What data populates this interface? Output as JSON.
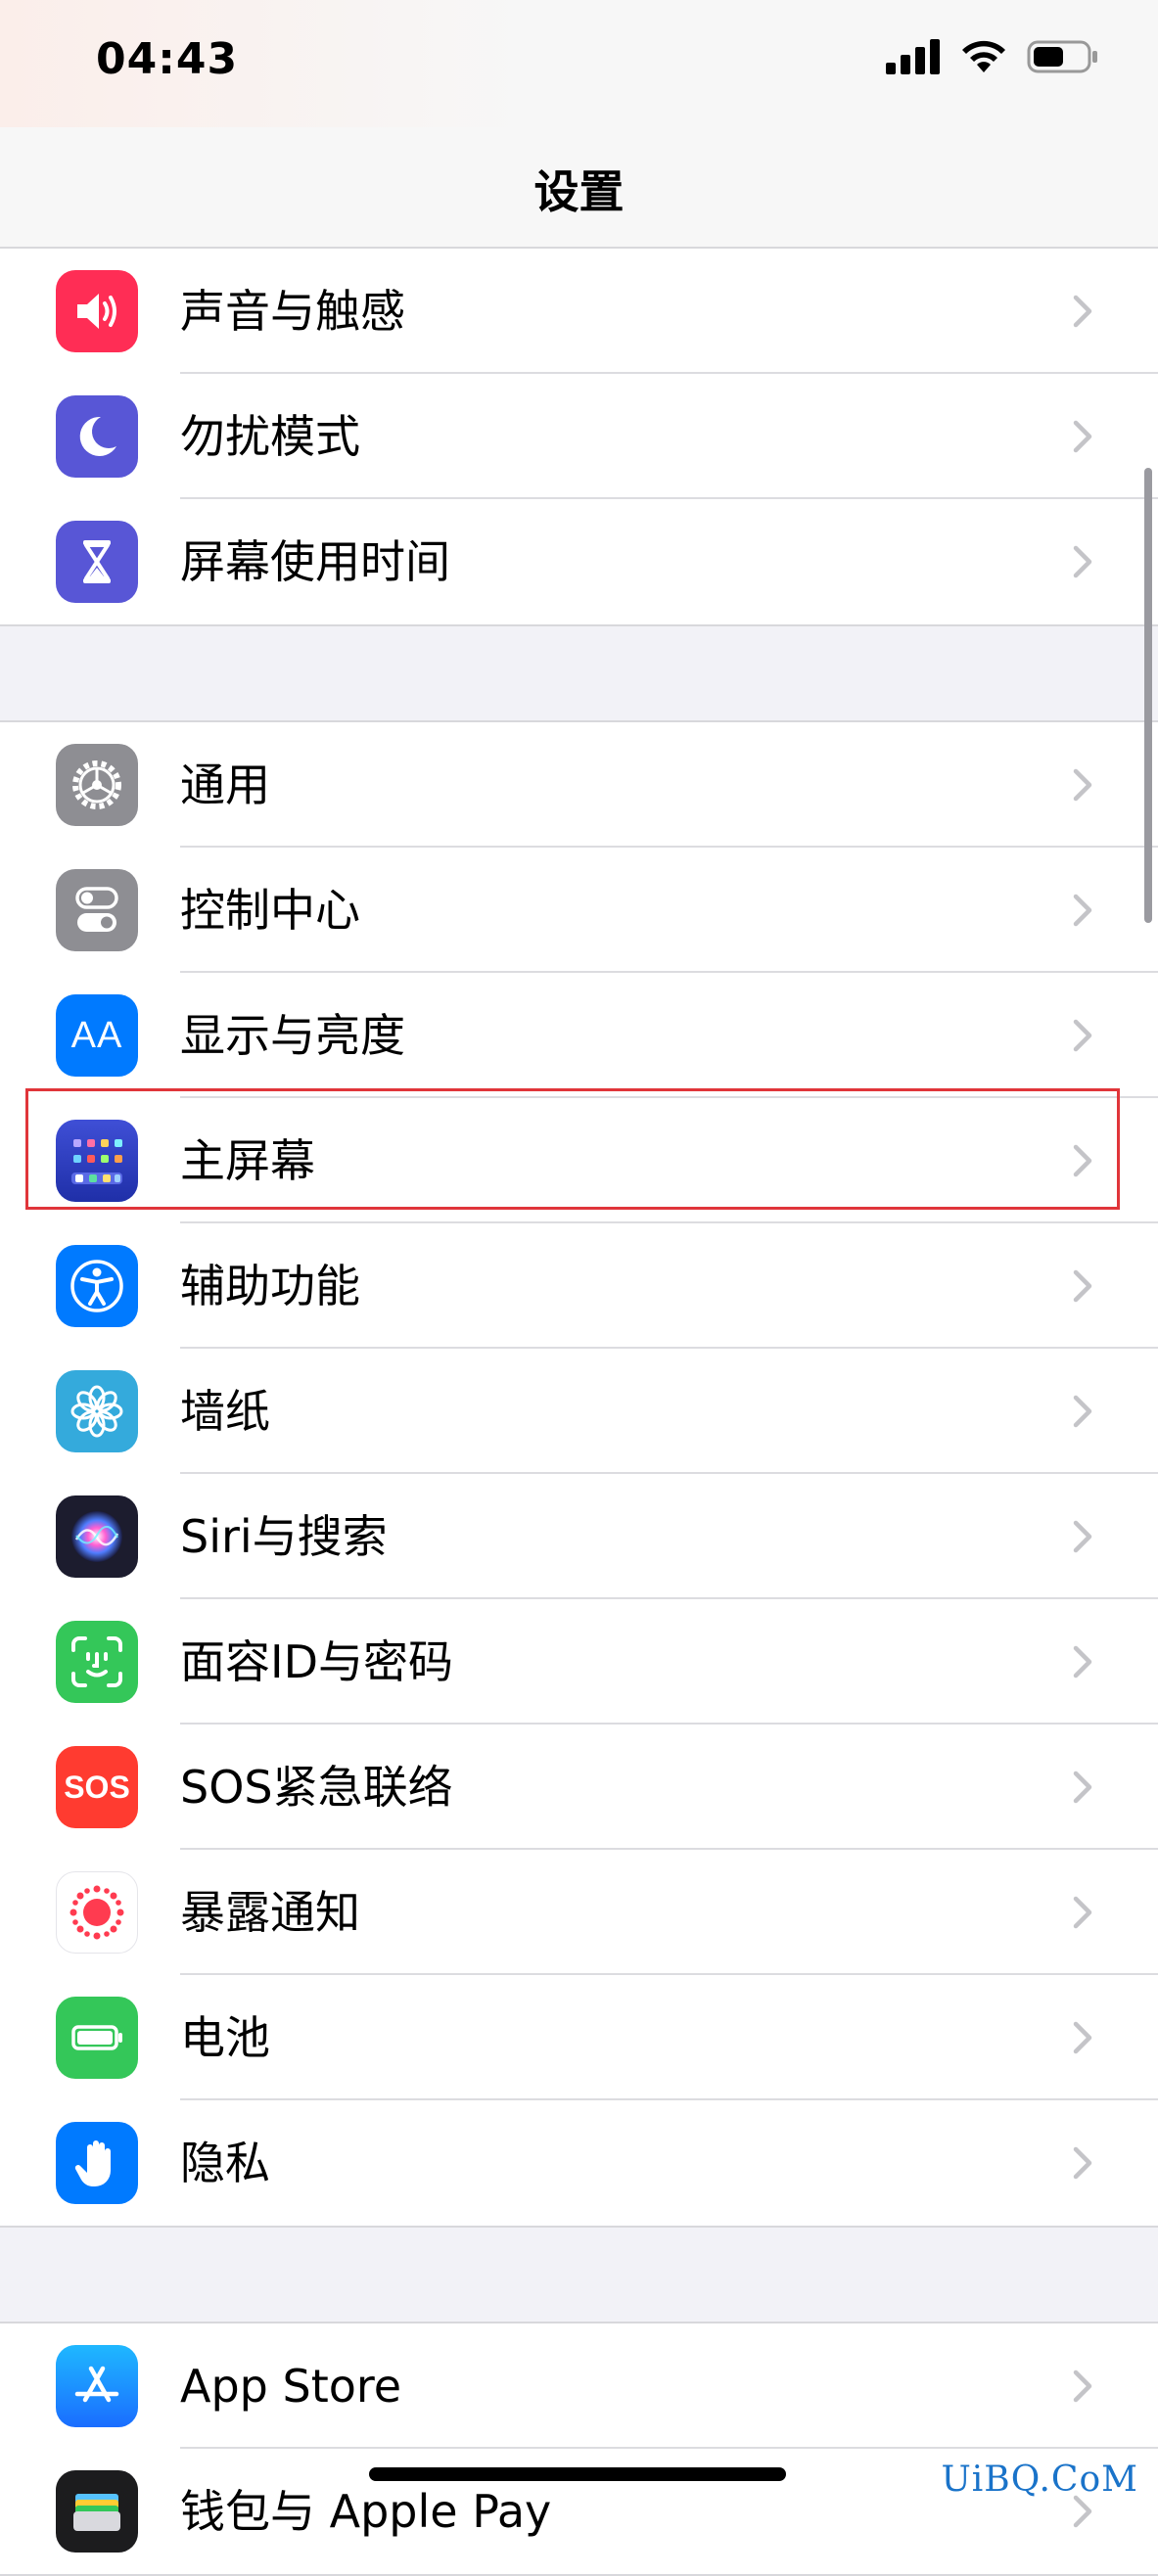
{
  "status_bar": {
    "time": "04:43"
  },
  "nav": {
    "title": "设置"
  },
  "groups": [
    {
      "items": [
        {
          "label": "声音与触感",
          "icon": "speaker-icon",
          "color": "#ff2d55"
        },
        {
          "label": "勿扰模式",
          "icon": "moon-icon",
          "color": "#5856d6"
        },
        {
          "label": "屏幕使用时间",
          "icon": "hourglass-icon",
          "color": "#5856d6"
        }
      ]
    },
    {
      "items": [
        {
          "label": "通用",
          "icon": "gear-icon",
          "color": "#8e8e93"
        },
        {
          "label": "控制中心",
          "icon": "toggles-icon",
          "color": "#8e8e93"
        },
        {
          "label": "显示与亮度",
          "icon": "text-size-icon",
          "color": "#007aff",
          "icon_text": "AA"
        },
        {
          "label": "主屏幕",
          "icon": "home-screen-icon",
          "color": "#2c3ec8"
        },
        {
          "label": "辅助功能",
          "icon": "accessibility-icon",
          "color": "#007aff"
        },
        {
          "label": "墙纸",
          "icon": "flower-icon",
          "color": "#34aadc"
        },
        {
          "label": "Siri与搜索",
          "icon": "siri-icon",
          "color": "#1c1c2e"
        },
        {
          "label": "面容ID与密码",
          "icon": "face-id-icon",
          "color": "#34c759"
        },
        {
          "label": "SOS紧急联络",
          "icon": "sos-icon",
          "color": "#ff3b30",
          "icon_text": "SOS"
        },
        {
          "label": "暴露通知",
          "icon": "exposure-icon",
          "color": "#ffffff"
        },
        {
          "label": "电池",
          "icon": "battery-icon",
          "color": "#34c759"
        },
        {
          "label": "隐私",
          "icon": "hand-icon",
          "color": "#007aff"
        }
      ]
    },
    {
      "items": [
        {
          "label": "App Store",
          "icon": "app-store-icon",
          "color": "#1a8cff"
        },
        {
          "label": "钱包与 Apple Pay",
          "icon": "wallet-icon",
          "color": "#1c1c1e"
        }
      ]
    }
  ],
  "watermark": "UiBQ.CoM"
}
